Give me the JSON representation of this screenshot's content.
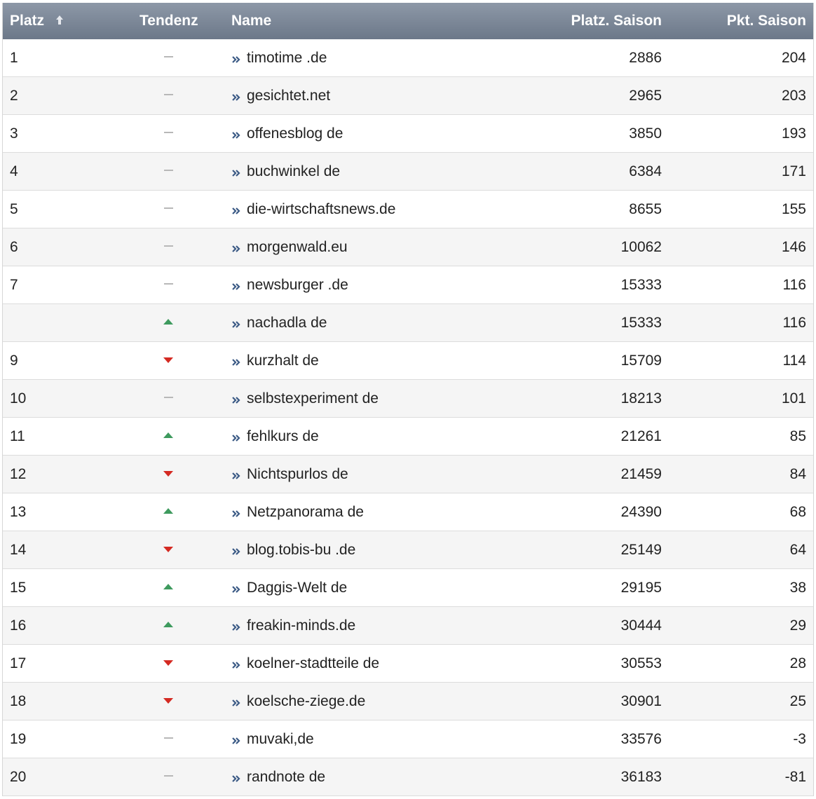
{
  "header": {
    "platz": "Platz",
    "tendenz": "Tendenz",
    "name": "Name",
    "platz_saison": "Platz. Saison",
    "pkt_saison": "Pkt. Saison"
  },
  "colors": {
    "up": "#3e9a5e",
    "down": "#d42a22",
    "flat": "#b8b8b8",
    "header": "#7a8594"
  },
  "rows": [
    {
      "platz": "1",
      "tendenz": "flat",
      "name": "timotime .de",
      "platz_saison": "2886",
      "pkt": "204"
    },
    {
      "platz": "2",
      "tendenz": "flat",
      "name": "gesichtet.net",
      "platz_saison": "2965",
      "pkt": "203"
    },
    {
      "platz": "3",
      "tendenz": "flat",
      "name": "offenesblog de",
      "platz_saison": "3850",
      "pkt": "193"
    },
    {
      "platz": "4",
      "tendenz": "flat",
      "name": "buchwinkel de",
      "platz_saison": "6384",
      "pkt": "171"
    },
    {
      "platz": "5",
      "tendenz": "flat",
      "name": "die-wirtschaftsnews.de",
      "platz_saison": "8655",
      "pkt": "155"
    },
    {
      "platz": "6",
      "tendenz": "flat",
      "name": "morgenwald.eu",
      "platz_saison": "10062",
      "pkt": "146"
    },
    {
      "platz": "7",
      "tendenz": "flat",
      "name": "newsburger .de",
      "platz_saison": "15333",
      "pkt": "116"
    },
    {
      "platz": "",
      "tendenz": "up",
      "name": "nachadla de",
      "platz_saison": "15333",
      "pkt": "116"
    },
    {
      "platz": "9",
      "tendenz": "down",
      "name": "kurzhalt de",
      "platz_saison": "15709",
      "pkt": "114"
    },
    {
      "platz": "10",
      "tendenz": "flat",
      "name": "selbstexperiment de",
      "platz_saison": "18213",
      "pkt": "101"
    },
    {
      "platz": "11",
      "tendenz": "up",
      "name": "fehlkurs de",
      "platz_saison": "21261",
      "pkt": "85"
    },
    {
      "platz": "12",
      "tendenz": "down",
      "name": "Nichtspurlos de",
      "platz_saison": "21459",
      "pkt": "84"
    },
    {
      "platz": "13",
      "tendenz": "up",
      "name": "Netzpanorama de",
      "platz_saison": "24390",
      "pkt": "68"
    },
    {
      "platz": "14",
      "tendenz": "down",
      "name": "blog.tobis-bu .de",
      "platz_saison": "25149",
      "pkt": "64"
    },
    {
      "platz": "15",
      "tendenz": "up",
      "name": "Daggis-Welt de",
      "platz_saison": "29195",
      "pkt": "38"
    },
    {
      "platz": "16",
      "tendenz": "up",
      "name": "freakin-minds.de",
      "platz_saison": "30444",
      "pkt": "29"
    },
    {
      "platz": "17",
      "tendenz": "down",
      "name": "koelner-stadtteile de",
      "platz_saison": "30553",
      "pkt": "28"
    },
    {
      "platz": "18",
      "tendenz": "down",
      "name": "koelsche-ziege.de",
      "platz_saison": "30901",
      "pkt": "25"
    },
    {
      "platz": "19",
      "tendenz": "flat",
      "name": "muvaki,de",
      "platz_saison": "33576",
      "pkt": "-3"
    },
    {
      "platz": "20",
      "tendenz": "flat",
      "name": "randnote de",
      "platz_saison": "36183",
      "pkt": "-81"
    }
  ]
}
